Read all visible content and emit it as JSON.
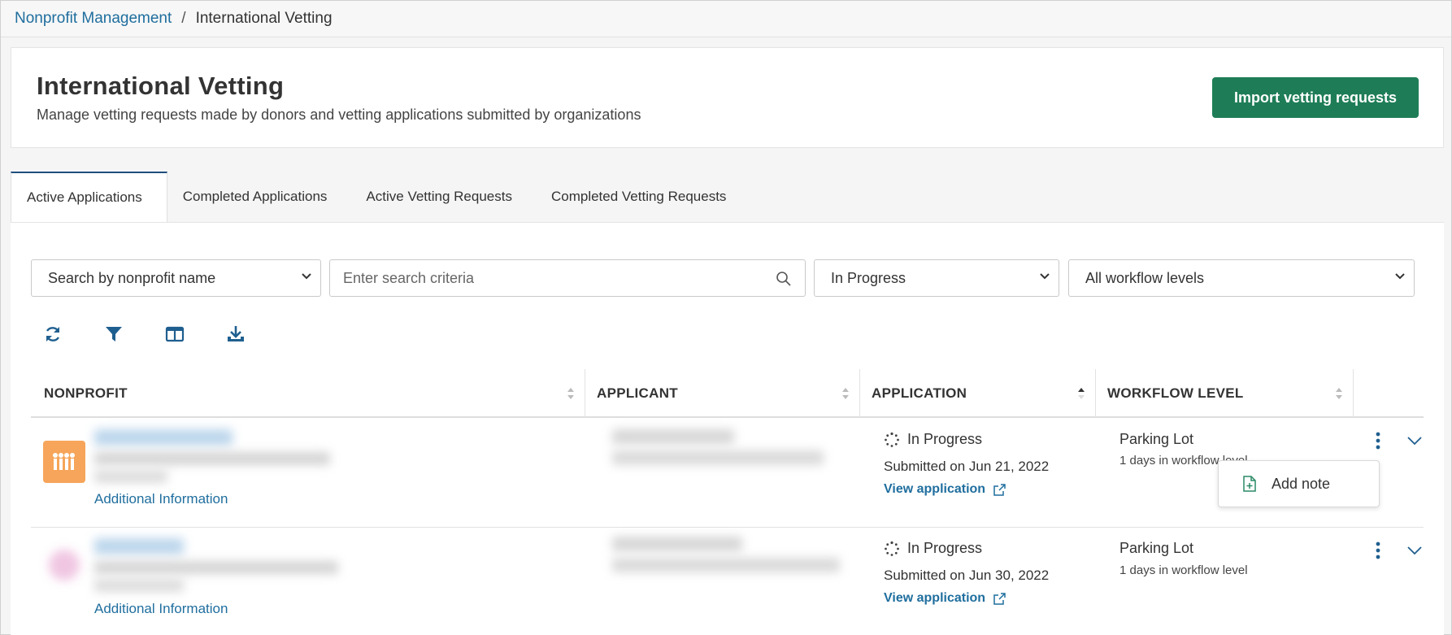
{
  "breadcrumb": {
    "parent": "Nonprofit Management",
    "separator": "/",
    "current": "International Vetting"
  },
  "header": {
    "title": "International Vetting",
    "subtitle": "Manage vetting requests made by donors and vetting applications submitted by organizations",
    "import_button": "Import vetting requests"
  },
  "tabs": [
    {
      "label": "Active Applications",
      "active": true
    },
    {
      "label": "Completed Applications",
      "active": false
    },
    {
      "label": "Active Vetting Requests",
      "active": false
    },
    {
      "label": "Completed Vetting Requests",
      "active": false
    }
  ],
  "filters": {
    "search_by": "Search by nonprofit name",
    "search_placeholder": "Enter search criteria",
    "status": "In Progress",
    "workflow": "All workflow levels"
  },
  "toolbar": {
    "icons": [
      "refresh-icon",
      "filter-icon",
      "columns-icon",
      "download-icon"
    ]
  },
  "table": {
    "columns": [
      "NONPROFIT",
      "APPLICANT",
      "APPLICATION",
      "WORKFLOW LEVEL"
    ],
    "sorted_column": "APPLICATION",
    "rows": [
      {
        "additional_info": "Additional Information",
        "status": "In Progress",
        "submitted": "Submitted on Jun 21, 2022",
        "view_application": "View application",
        "workflow_level": "Parking Lot",
        "days": "1 days in workflow level"
      },
      {
        "additional_info": "Additional Information",
        "status": "In Progress",
        "submitted": "Submitted on Jun 30, 2022",
        "view_application": "View application",
        "workflow_level": "Parking Lot",
        "days": "1 days in workflow level"
      }
    ]
  },
  "menu": {
    "add_note": "Add note"
  },
  "colors": {
    "primary_button": "#1e7d57",
    "link": "#1f6e9e",
    "accent_icon": "#1f5f8f",
    "logo_bg": "#f6a55a"
  }
}
